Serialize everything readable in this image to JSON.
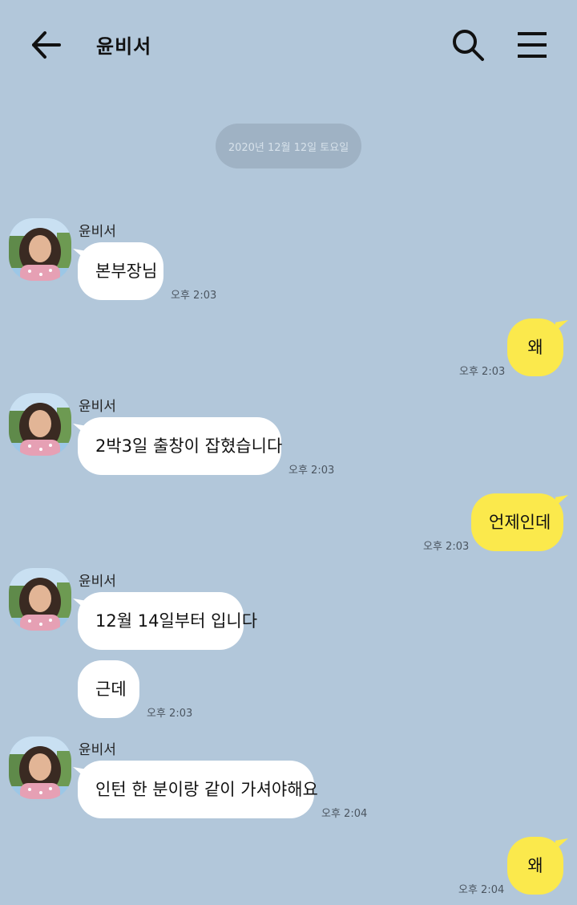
{
  "header": {
    "title": "윤비서",
    "back_icon": "arrow-left-icon",
    "search_icon": "search-icon",
    "menu_icon": "hamburger-menu-icon"
  },
  "date_divider": "2020년 12월 12일 토요일",
  "messages": [
    {
      "from": "other",
      "sender": "윤비서",
      "text": "본부장님",
      "time": "오후 2:03"
    },
    {
      "from": "me",
      "text": "왜",
      "time": "오후 2:03"
    },
    {
      "from": "other",
      "sender": "윤비서",
      "text": "2박3일 출창이 잡혔습니다",
      "time": "오후 2:03"
    },
    {
      "from": "me",
      "text": "언제인데",
      "time": "오후 2:03"
    },
    {
      "from": "other",
      "sender": "윤비서",
      "text": "12월 14일부터 입니다"
    },
    {
      "from": "other",
      "text": "근데",
      "time": "오후 2:03"
    },
    {
      "from": "other",
      "sender": "윤비서",
      "text": "인턴 한 분이랑 같이 가셔야해요",
      "time": "오후 2:04"
    },
    {
      "from": "me",
      "text": "왜",
      "time": "오후 2:04"
    }
  ],
  "colors": {
    "background": "#b2c7da",
    "sent_bubble": "#fbe94c",
    "received_bubble": "#ffffff",
    "date_pill": "#9fb2c4"
  }
}
